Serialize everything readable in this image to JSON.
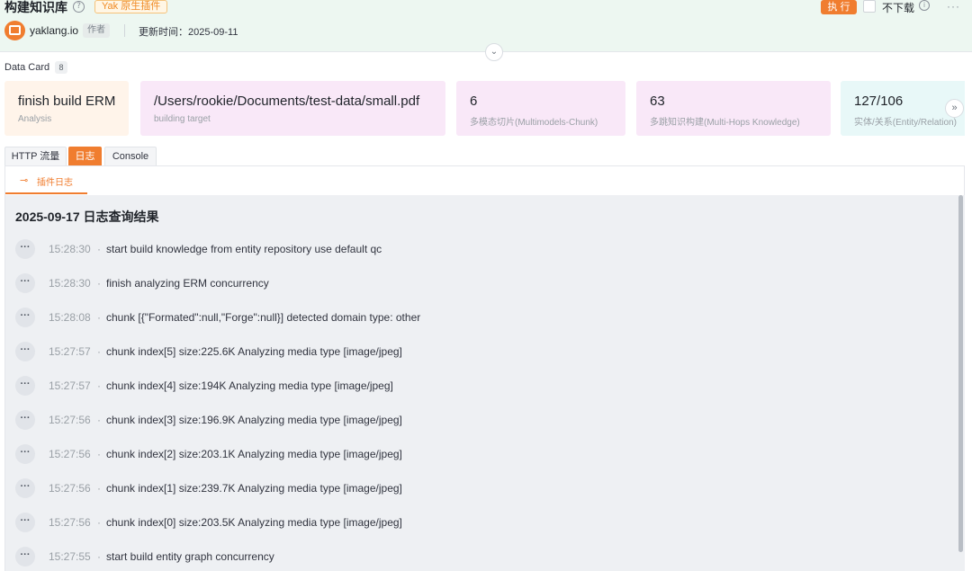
{
  "header": {
    "title": "构建知识库",
    "help_icon": "?",
    "plugin_tag": "Yak 原生插件",
    "author": "yaklang.io",
    "author_tag": "作者",
    "update_time": "更新时间：2025-09-11",
    "execute_label": "执 行",
    "no_download_label": "不下载",
    "info_icon": "i",
    "more_icon": "···",
    "collapse_icon": "chevrons-down-icon"
  },
  "data_card": {
    "label": "Data Card",
    "count": "8",
    "cards": [
      {
        "value": "finish build ERM",
        "sub": "Analysis",
        "bg": "#fff4ea"
      },
      {
        "value": "/Users/rookie/Documents/test-data/small.pdf",
        "sub": "building target",
        "bg": "#f9e8f8"
      },
      {
        "value": "6",
        "sub": "多模态切片(Multimodels-Chunk)",
        "bg": "#f9e8f8"
      },
      {
        "value": "63",
        "sub": "多跳知识构建(Multi-Hops Knowledge)",
        "bg": "#f9e8f8"
      },
      {
        "value": "127/106",
        "sub": "实体/关系(Entity/Relation)",
        "bg": "#e8f8f8"
      }
    ],
    "next_icon": "»"
  },
  "tabs": [
    {
      "label": "HTTP 流量",
      "active": false
    },
    {
      "label": "日志",
      "active": true
    },
    {
      "label": "Console",
      "active": false
    }
  ],
  "subtab": {
    "label": "插件日志",
    "icon": "plugin-log-icon"
  },
  "log": {
    "heading": "2025-09-17 日志查询结果",
    "entries": [
      {
        "time": "15:28:30",
        "message": "start build knowledge from entity repository use default qc"
      },
      {
        "time": "15:28:30",
        "message": "finish analyzing ERM concurrency"
      },
      {
        "time": "15:28:08",
        "message": "chunk [{\"Formated\":null,\"Forge\":null}] detected domain type: other"
      },
      {
        "time": "15:27:57",
        "message": "chunk index[5] size:225.6K Analyzing media type [image/jpeg]"
      },
      {
        "time": "15:27:57",
        "message": "chunk index[4] size:194K Analyzing media type [image/jpeg]"
      },
      {
        "time": "15:27:56",
        "message": "chunk index[3] size:196.9K Analyzing media type [image/jpeg]"
      },
      {
        "time": "15:27:56",
        "message": "chunk index[2] size:203.1K Analyzing media type [image/jpeg]"
      },
      {
        "time": "15:27:56",
        "message": "chunk index[1] size:239.7K Analyzing media type [image/jpeg]"
      },
      {
        "time": "15:27:56",
        "message": "chunk index[0] size:203.5K Analyzing media type [image/jpeg]"
      },
      {
        "time": "15:27:55",
        "message": "start build entity graph concurrency"
      }
    ]
  }
}
